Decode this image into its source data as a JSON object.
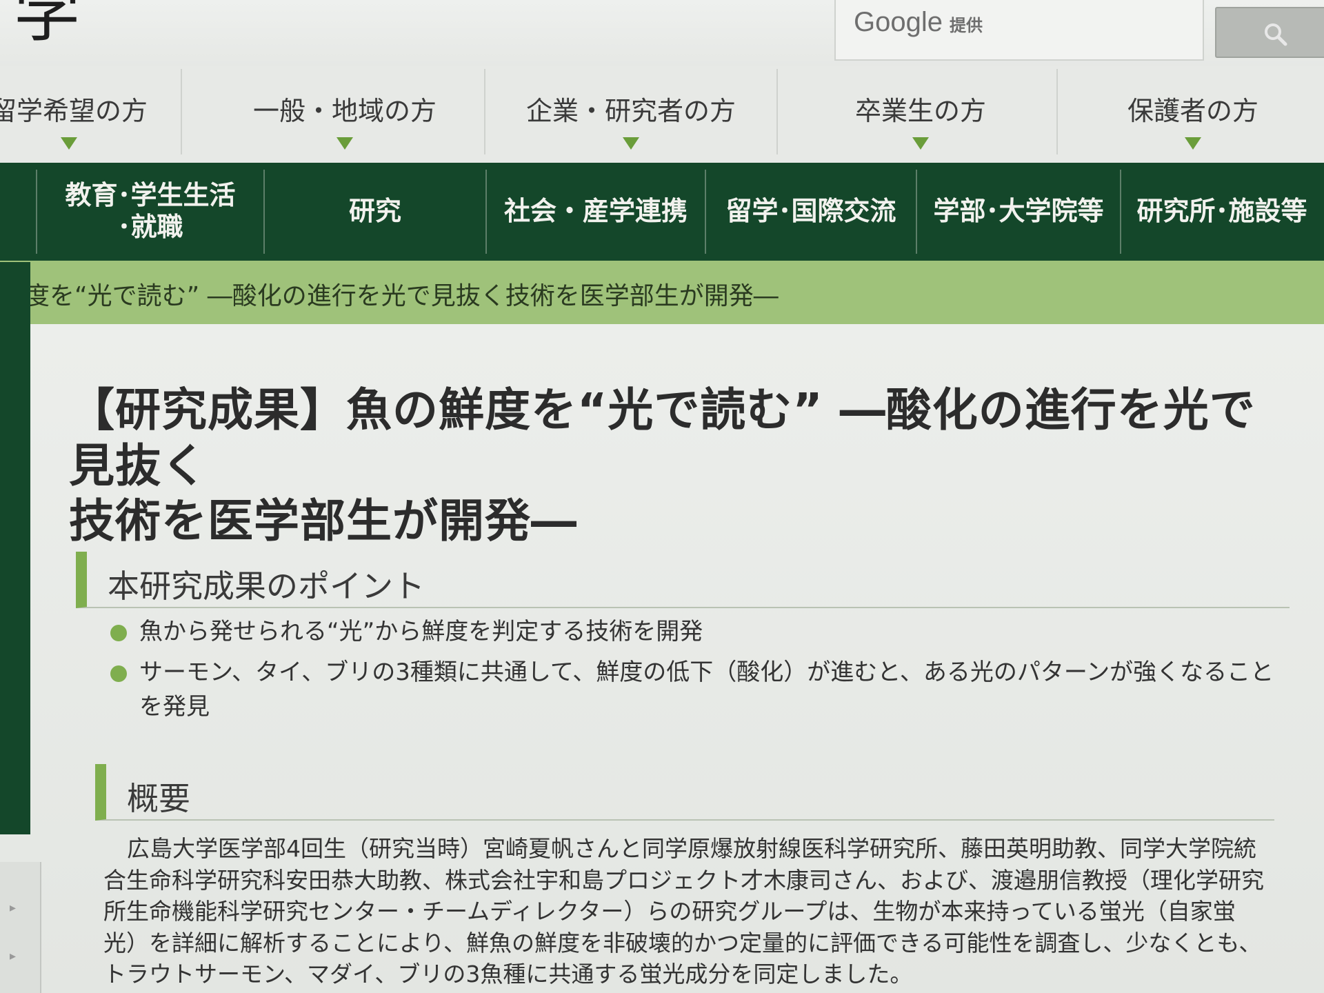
{
  "header": {
    "logo_fragment": "学",
    "search_brand": "Google",
    "search_brand_suffix": "提供"
  },
  "audience_nav": [
    {
      "label": "留学希望の方"
    },
    {
      "label": "一般・地域の方"
    },
    {
      "label": "企業・研究者の方"
    },
    {
      "label": "卒業生の方"
    },
    {
      "label": "保護者の方"
    }
  ],
  "main_nav": [
    {
      "line1": "教育･学生生活",
      "line2": "･就職"
    },
    {
      "line1": "研究",
      "line2": ""
    },
    {
      "line1": "社会・産学連携",
      "line2": ""
    },
    {
      "line1": "留学･国際交流",
      "line2": ""
    },
    {
      "line1": "学部･大学院等",
      "line2": ""
    },
    {
      "line1": "研究所･施設等",
      "line2": ""
    }
  ],
  "breadcrumb": "鮮度を“光で読む” ―酸化の進行を光で見抜く技術を医学部生が開発―",
  "article": {
    "title_line1": "【研究成果】魚の鮮度を“光で読む” ―酸化の進行を光で見抜く",
    "title_line2": "技術を医学部生が開発―",
    "points_heading": "本研究成果のポイント",
    "points": [
      "魚から発せられる“光”から鮮度を判定する技術を開発",
      "サーモン、タイ、ブリの3種類に共通して、鮮度の低下（酸化）が進むと、ある光のパターンが強くなることを発見"
    ],
    "summary_heading": "概要",
    "summary_text": "広島大学医学部4回生（研究当時）宮崎夏帆さんと同学原爆放射線医科学研究所、藤田英明助教、同学大学院統合生命科学研究科安田恭大助教、株式会社宇和島プロジェクト才木康司さん、および、渡邉朋信教授（理化学研究所生命機能科学研究センター・チームディレクター）らの研究グループは、生物が本来持っている蛍光（自家蛍光）を詳細に解析することにより、鮮魚の鮮度を非破壊的かつ定量的に評価できる可能性を調査し、少なくとも、トラウトサーモン、マダイ、ブリの3魚種に共通する蛍光成分を同定しました。"
  },
  "colors": {
    "nav_green": "#14472a",
    "accent_green": "#7fae4e",
    "breadcrumb_green": "#9fc27a"
  },
  "icons": [
    "search-icon",
    "triangle-down-icon",
    "bullet-icon"
  ]
}
